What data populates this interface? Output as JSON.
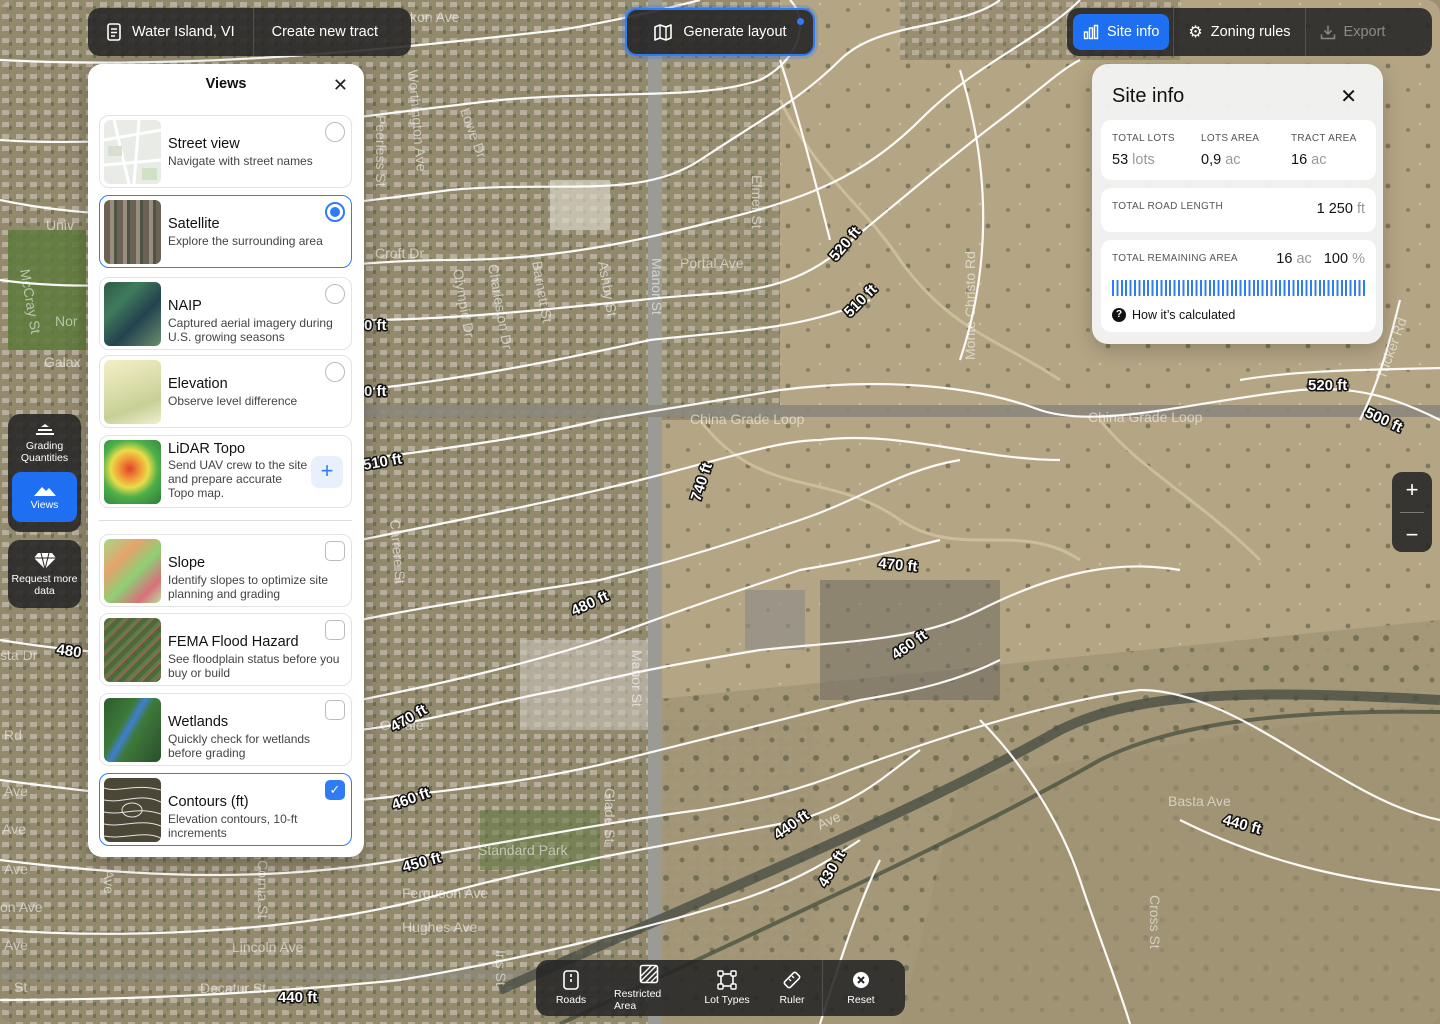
{
  "colors": {
    "accent": "#2f7cf6",
    "toolbar_bg": "#262626",
    "contour_line": "#ffffff",
    "satellite_base": "#a89a7c"
  },
  "top_bar": {
    "location_label": "Water Island, VI",
    "location_icon": "document-icon",
    "create_tract_label": "Create new tract",
    "generate_label": "Generate layout",
    "generate_icon": "map-sparkle-icon",
    "site_info_label": "Site info",
    "zoning_rules_label": "Zoning rules",
    "export_label": "Export"
  },
  "views_panel": {
    "title": "Views",
    "items": [
      {
        "name": "Street view",
        "desc": "Navigate with street names",
        "control": "radio",
        "checked": false
      },
      {
        "name": "Satellite",
        "desc": "Explore the surrounding area",
        "control": "radio",
        "checked": true
      },
      {
        "name": "NAIP",
        "desc": "Captured aerial imagery during U.S. growing seasons",
        "control": "radio",
        "checked": false
      },
      {
        "name": "Elevation",
        "desc": "Observe level difference",
        "control": "radio",
        "checked": false
      },
      {
        "name": "LiDAR Topo",
        "desc": "Send UAV crew to the site and prepare accurate Topo map.",
        "control": "plus",
        "checked": false
      },
      {
        "name": "Slope",
        "desc": "Identify slopes to optimize site planning and grading",
        "control": "checkbox",
        "checked": false
      },
      {
        "name": "FEMA Flood Hazard",
        "desc": "See floodplain status before you buy or build",
        "control": "checkbox",
        "checked": false
      },
      {
        "name": "Wetlands",
        "desc": "Quickly check for wetlands before grading",
        "control": "checkbox",
        "checked": false
      },
      {
        "name": "Contours (ft)",
        "desc": "Elevation contours, 10-ft increments",
        "control": "checkbox",
        "checked": true
      }
    ]
  },
  "side_rail": {
    "grading_label": "Grading Quantities",
    "views_label": "Views",
    "request_label": "Request more data"
  },
  "site_info": {
    "title": "Site info",
    "total_lots_label": "TOTAL LOTS",
    "total_lots_value": "53",
    "total_lots_unit": "lots",
    "lots_area_label": "LOTS AREA",
    "lots_area_value": "0,9",
    "lots_area_unit": "ac",
    "tract_area_label": "TRACT AREA",
    "tract_area_value": "16",
    "tract_area_unit": "ac",
    "road_length_label": "TOTAL ROAD LENGTH",
    "road_length_value": "1 250",
    "road_length_unit": "ft",
    "remaining_label": "TOTAL REMAINING AREA",
    "remaining_value": "16",
    "remaining_unit": "ac",
    "remaining_pct": "100",
    "remaining_pct_unit": "%",
    "remaining_fraction": 1.0,
    "how_label": "How it’s calculated"
  },
  "zoom": {
    "in": "+",
    "out": "−"
  },
  "bottom_toolbar": {
    "roads": "Roads",
    "restricted": "Restricted Area",
    "lot_types": "Lot Types",
    "ruler": "Ruler",
    "reset": "Reset"
  },
  "map": {
    "contour_labels": [
      "520 ft",
      "510 ft",
      "0 ft",
      "0 ft",
      "510 ft",
      "740 ft",
      "520 ft",
      "500 ft",
      "470 ft",
      "480 ft",
      "460 ft",
      "480",
      "470 ft",
      "460 ft",
      "450 ft",
      "440 ft",
      "440 ft",
      "430 ft",
      "440 ft"
    ],
    "street_labels": [
      "kon Ave",
      "Worthington Ave",
      "Lowe Dr",
      "Peerless St",
      "Elmer St",
      "Portal Ave",
      "Croft Dr",
      "Olympic Dr",
      "Charleston Dr",
      "Ashby St",
      "Barnett St",
      "Manor St",
      "Monte Christo Rd",
      "China Grade Loop",
      "China Grade Loop",
      "Tucker Rd",
      "Univ",
      "McCray St",
      "Nor",
      "Galax",
      "Carrere St",
      "Manor St",
      "Glade St",
      "Oildale",
      "Standard Park",
      "Ferguson Ave",
      "Hughes Ave",
      "Lincoln Ave",
      "Decatur St",
      "Iris St",
      "Cornia St",
      "Basta Ave",
      "Ave",
      "Cross St",
      "sta Dr",
      "Rd",
      "Ave",
      "Ave",
      "Ave",
      "on Ave",
      "Ave",
      "Ave",
      "St"
    ]
  }
}
